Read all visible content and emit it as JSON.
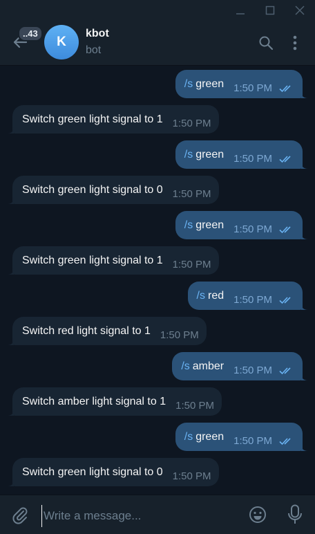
{
  "header": {
    "unread_count": "..43",
    "avatar_letter": "K",
    "chat_name": "kbot",
    "status": "bot"
  },
  "messages": [
    {
      "dir": "out",
      "cmd": "/s",
      "text": "green",
      "time": "1:50 PM"
    },
    {
      "dir": "in",
      "text": "Switch green light signal to 1",
      "time": "1:50 PM"
    },
    {
      "dir": "out",
      "cmd": "/s",
      "text": "green",
      "time": "1:50 PM"
    },
    {
      "dir": "in",
      "text": "Switch green light signal to 0",
      "time": "1:50 PM"
    },
    {
      "dir": "out",
      "cmd": "/s",
      "text": "green",
      "time": "1:50 PM"
    },
    {
      "dir": "in",
      "text": "Switch green light signal to 1",
      "time": "1:50 PM"
    },
    {
      "dir": "out",
      "cmd": "/s",
      "text": "red",
      "time": "1:50 PM"
    },
    {
      "dir": "in",
      "text": "Switch red light signal to 1",
      "time": "1:50 PM"
    },
    {
      "dir": "out",
      "cmd": "/s",
      "text": "amber",
      "time": "1:50 PM"
    },
    {
      "dir": "in",
      "text": "Switch amber light signal to 1",
      "time": "1:50 PM"
    },
    {
      "dir": "out",
      "cmd": "/s",
      "text": "green",
      "time": "1:50 PM"
    },
    {
      "dir": "in",
      "text": "Switch green light signal to 0",
      "time": "1:50 PM"
    }
  ],
  "composer": {
    "value": "",
    "placeholder": "Write a message..."
  },
  "colors": {
    "background": "#0e1621",
    "panel": "#17212b",
    "outgoing_bubble": "#2b5278",
    "incoming_bubble": "#182533",
    "command": "#6ab3f3"
  },
  "icons": [
    "minimize-icon",
    "maximize-icon",
    "close-icon",
    "back-arrow-icon",
    "search-icon",
    "more-icon",
    "attach-icon",
    "emoji-icon",
    "mic-icon",
    "double-check-icon"
  ]
}
